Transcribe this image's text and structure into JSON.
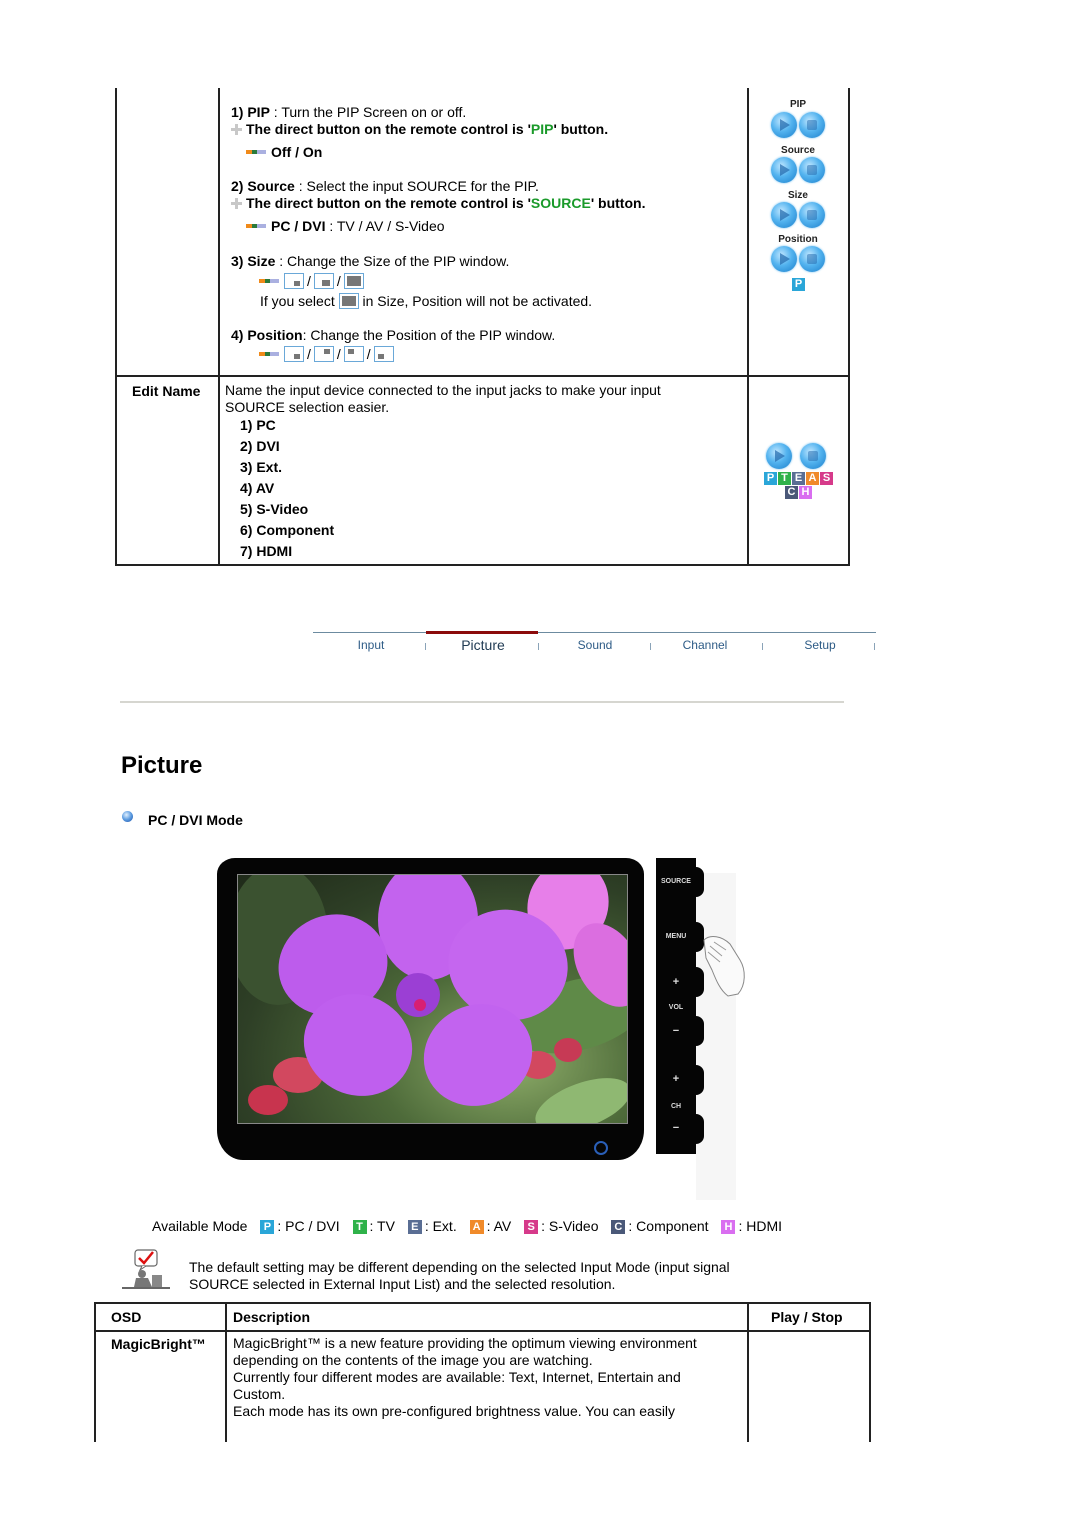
{
  "pip_section": {
    "items": [
      {
        "num": "1)",
        "name": "PIP",
        "desc": " : Turn the PIP Screen on or off.",
        "direct_pre": "The direct button on the remote control is '",
        "direct_key": "PIP",
        "direct_post": "' button.",
        "options": "Off / On"
      },
      {
        "num": "2)",
        "name": "Source",
        "desc": " : Select the input SOURCE for the PIP.",
        "direct_pre": "The direct button on the remote control is '",
        "direct_key": "SOURCE",
        "direct_post": "' button.",
        "options_bold": "PC / DVI",
        "options_rest": " : TV / AV / S-Video"
      },
      {
        "num": "3)",
        "name": "Size",
        "desc": " : Change the Size of the PIP window.",
        "note_pre": "If you select ",
        "note_post": " in Size, Position will not be activated."
      },
      {
        "num": "4)",
        "name": "Position",
        "desc": ": Change the Position of the PIP window."
      }
    ],
    "slash": "/",
    "buttons": [
      {
        "label": "PIP"
      },
      {
        "label": "Source"
      },
      {
        "label": "Size"
      },
      {
        "label": "Position"
      }
    ],
    "mode_tile": "P"
  },
  "edit_name": {
    "label": "Edit Name",
    "desc_line1": "Name the input device connected to the input jacks to make your input",
    "desc_line2": "SOURCE selection easier.",
    "items": [
      "1)  PC",
      "2)  DVI",
      "3)  Ext.",
      "4)  AV",
      "5)  S-Video",
      "6)  Component",
      "7)  HDMI"
    ],
    "tiles_row1": [
      {
        "letter": "P",
        "color": "#2aa6d8"
      },
      {
        "letter": "T",
        "color": "#2fb24a"
      },
      {
        "letter": "E",
        "color": "#5a6e94"
      },
      {
        "letter": "A",
        "color": "#f08a2a"
      },
      {
        "letter": "S",
        "color": "#d63a8a"
      }
    ],
    "tiles_row2": [
      {
        "letter": "C",
        "color": "#4a5878"
      },
      {
        "letter": "H",
        "color": "#d96ef0"
      }
    ]
  },
  "nav": {
    "tabs": [
      {
        "label": "Input",
        "active": false
      },
      {
        "label": "Picture",
        "active": true
      },
      {
        "label": "Sound",
        "active": false
      },
      {
        "label": "Channel",
        "active": false
      },
      {
        "label": "Setup",
        "active": false
      }
    ],
    "active_color": "#8b0b0b"
  },
  "page": {
    "title": "Picture",
    "subheading": "PC / DVI Mode"
  },
  "monitor": {
    "side_buttons": [
      "SOURCE",
      "MENU",
      "+",
      "VOL",
      "−",
      "+",
      "CH",
      "−"
    ]
  },
  "available_modes": {
    "label": "Available Mode",
    "modes": [
      {
        "letter": "P",
        "label": ": PC / DVI",
        "color": "#2aa6d8"
      },
      {
        "letter": "T",
        "label": ": TV",
        "color": "#2fb24a"
      },
      {
        "letter": "E",
        "label": ": Ext.",
        "color": "#5a6e94"
      },
      {
        "letter": "A",
        "label": ": AV",
        "color": "#f08a2a"
      },
      {
        "letter": "S",
        "label": ": S-Video",
        "color": "#d63a8a"
      },
      {
        "letter": "C",
        "label": ": Component",
        "color": "#4a5878"
      },
      {
        "letter": "H",
        "label": ": HDMI",
        "color": "#d96ef0"
      }
    ]
  },
  "note": {
    "line1": "The default setting may be different depending on the selected Input Mode (input signal",
    "line2": "SOURCE selected in External Input List) and the selected resolution."
  },
  "osd_table": {
    "headers": [
      "OSD",
      "Description",
      "Play / Stop"
    ],
    "rows": [
      {
        "osd": "MagicBright™",
        "description": [
          "MagicBright™ is a new feature providing the optimum viewing environment",
          "depending on the contents of the image you are watching.",
          "Currently four different modes are available: Text, Internet, Entertain and",
          "Custom.",
          "Each mode has its own pre-configured brightness value. You can easily"
        ],
        "play_stop": ""
      }
    ]
  }
}
